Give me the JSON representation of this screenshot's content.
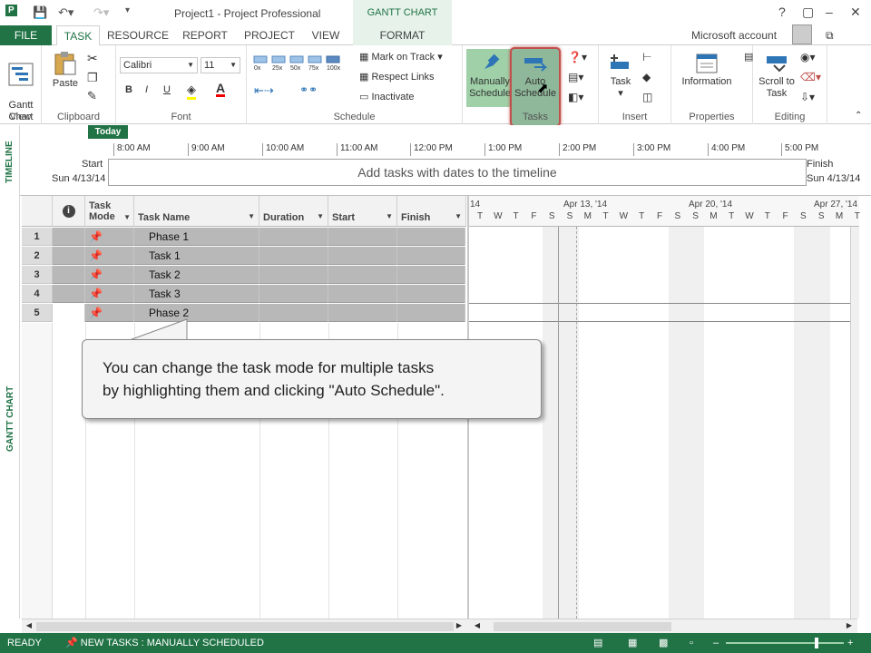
{
  "titlebar": {
    "title": "Project1 - Project Professional",
    "context_tab_group": "GANTT CHART TOOLS",
    "help": "?"
  },
  "tabs": [
    "FILE",
    "TASK",
    "RESOURCE",
    "REPORT",
    "PROJECT",
    "VIEW",
    "FORMAT"
  ],
  "account": "Microsoft account",
  "ribbon": {
    "view": {
      "gantt_label": "Gantt\nChart",
      "group": "View"
    },
    "clipboard": {
      "paste": "Paste",
      "group": "Clipboard"
    },
    "font": {
      "family": "Calibri",
      "size": "11",
      "bold": "B",
      "italic": "I",
      "underline": "U",
      "color_glyph": "A",
      "group": "Font"
    },
    "schedule": {
      "pcts": [
        "0x",
        "25x",
        "50x",
        "75x",
        "100x"
      ],
      "mark_on_track": "Mark on Track",
      "respect_links": "Respect Links",
      "inactivate": "Inactivate",
      "group": "Schedule"
    },
    "tasks": {
      "manually": "Manually Schedule",
      "auto": "Auto Schedule",
      "group": "Tasks"
    },
    "insert": {
      "task": "Task",
      "group": "Insert"
    },
    "properties": {
      "information": "Information",
      "group": "Properties"
    },
    "editing": {
      "scroll": "Scroll to Task",
      "group": "Editing"
    }
  },
  "timeline": {
    "side_label": "TIMELINE",
    "today": "Today",
    "start_label": "Start",
    "start_date": "Sun 4/13/14",
    "finish_label": "Finish",
    "finish_date": "Sun 4/13/14",
    "placeholder": "Add tasks with dates to the timeline",
    "ticks": [
      "8:00 AM",
      "9:00 AM",
      "10:00 AM",
      "11:00 AM",
      "12:00 PM",
      "1:00 PM",
      "2:00 PM",
      "3:00 PM",
      "4:00 PM",
      "5:00 PM"
    ]
  },
  "grid": {
    "side_label": "GANTT CHART",
    "headers": {
      "mode": "Task Mode",
      "name": "Task Name",
      "duration": "Duration",
      "start": "Start",
      "finish": "Finish"
    },
    "rows": [
      {
        "id": "1",
        "name": "Phase 1"
      },
      {
        "id": "2",
        "name": "Task 1"
      },
      {
        "id": "3",
        "name": "Task 2"
      },
      {
        "id": "4",
        "name": "Task 3"
      },
      {
        "id": "5",
        "name": "Phase 2"
      }
    ]
  },
  "chart": {
    "weeks": [
      "14",
      "Apr 13, '14",
      "Apr 20, '14",
      "Apr 27, '14"
    ],
    "days": [
      "T",
      "W",
      "T",
      "F",
      "S",
      "S",
      "M",
      "T",
      "W",
      "T",
      "F",
      "S",
      "S",
      "M",
      "T",
      "W",
      "T",
      "F",
      "S",
      "S",
      "M",
      "T",
      "W"
    ]
  },
  "callout": {
    "line1": "You can change the task mode for multiple tasks",
    "line2": "by highlighting them and clicking \"Auto Schedule\"."
  },
  "status": {
    "ready": "READY",
    "new_tasks": "NEW TASKS : MANUALLY SCHEDULED"
  },
  "colors": {
    "accent": "#217346",
    "selection": "#b8b8b8"
  }
}
